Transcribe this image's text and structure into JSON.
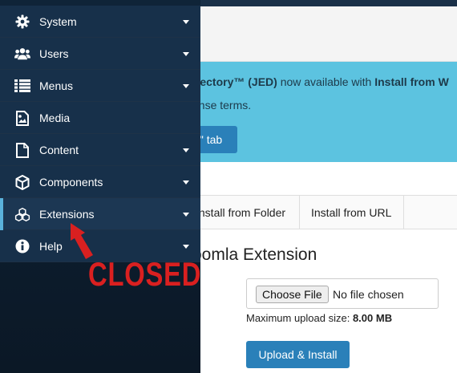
{
  "banner": {
    "line1_bold1": "irectory™ (JED)",
    "line1_mid": " now available with ",
    "line1_bold2": "Install from W",
    "line2": "ense terms.",
    "tab_button": "\" tab"
  },
  "tabs": {
    "folder": "Install from Folder",
    "url": "Install from URL"
  },
  "package": {
    "title": "oomla Extension",
    "choose_file": "Choose File",
    "no_file": "No file chosen",
    "max_size_label": "Maximum upload size: ",
    "max_size_value": "8.00 MB",
    "upload_button": "Upload & Install"
  },
  "sidebar": {
    "items": [
      {
        "label": "System",
        "icon": "gear-icon"
      },
      {
        "label": "Users",
        "icon": "users-icon"
      },
      {
        "label": "Menus",
        "icon": "list-icon"
      },
      {
        "label": "Media",
        "icon": "image-icon"
      },
      {
        "label": "Content",
        "icon": "file-icon"
      },
      {
        "label": "Components",
        "icon": "cube-icon"
      },
      {
        "label": "Extensions",
        "icon": "cubes-icon"
      },
      {
        "label": "Help",
        "icon": "info-icon"
      }
    ]
  },
  "annotation": {
    "text": "CLOSED",
    "color": "#d92020"
  },
  "colors": {
    "sidebar_bg": "#17304a",
    "accent": "#2a80b9",
    "banner_bg": "#5cc3e0",
    "active_marker": "#5ab2dc"
  }
}
